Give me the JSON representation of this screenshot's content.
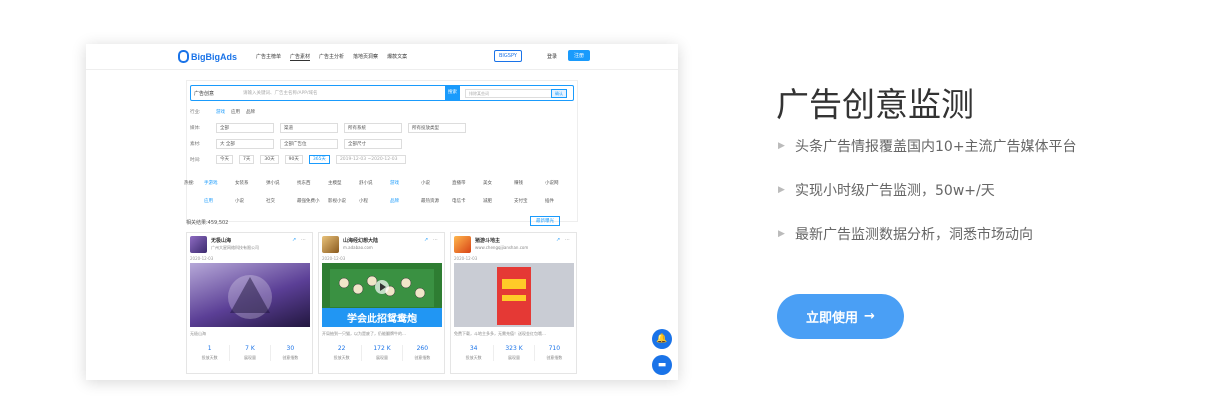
{
  "screenshot": {
    "header": {
      "logo": "BigBigAds",
      "nav": [
        "广告主榜单",
        "广告素材",
        "广告主分析",
        "落地页洞察",
        "爆款文案"
      ],
      "bigspy": "BIGSPY",
      "login": "登录",
      "register": "注册"
    },
    "search": {
      "select": "广告创意",
      "placeholder": "请输入关键词、广告主名称/APP/域名",
      "button": "搜索",
      "exclude_placeholder": "排除某些词",
      "exclude_button": "确认"
    },
    "filters": {
      "industry_label": "行业:",
      "industry": [
        "游戏",
        "应用",
        "品牌"
      ],
      "media_label": "媒体:",
      "media_dd": [
        "全部",
        "渠道",
        "所有系统",
        "所有投放类型"
      ],
      "creative_label": "素材:",
      "creative_dd": [
        "大 全部",
        "全部广告位",
        "全部尺寸"
      ],
      "time_label": "时间:",
      "time_opts": [
        "今天",
        "7天",
        "30天",
        "90天",
        "365天"
      ],
      "date_range": "2019-12-03 ~2020-12-03"
    },
    "hot_label": "热搜:",
    "hot_row1": [
      "手游戏",
      "女装系",
      "弹小说",
      "找东西",
      "主模型",
      "舒小说",
      "游戏",
      "小说",
      "直播带",
      "美女",
      "赚钱",
      "小说网"
    ],
    "hot_row2": [
      "应用",
      "小说",
      "社交",
      "最强免费小",
      "影视小说",
      "小程",
      "品牌",
      "最热资源",
      "电信卡",
      "减肥",
      "支付宝",
      "插件"
    ],
    "result_count": "相关结果:459,502",
    "sort": "最新曝光",
    "cards": [
      {
        "name": "无极山海",
        "company": "广州大星网络科技有限公司",
        "date": "2020-12-03",
        "desc": "无极山海",
        "stats": [
          "1",
          "7 K",
          "30"
        ],
        "stat_labels": [
          "投放天数",
          "展现量",
          "创意指数"
        ],
        "image_text": "",
        "color": "#6b4fa3"
      },
      {
        "name": "山海经幻想大陆",
        "company": "m.adabao.com",
        "date": "2020-12-03",
        "desc": "开局抽到一只猫，以为是废了，仍能翻牌牛的…",
        "stats": [
          "22",
          "172 K",
          "260"
        ],
        "stat_labels": [
          "投放天数",
          "展现量",
          "创意指数"
        ],
        "image_text": "学会此招鸳鸯炮",
        "color": "#2e7d32"
      },
      {
        "name": "猪游斗地主",
        "company": "www.chengqijianshan.com",
        "date": "2020-12-03",
        "desc": "免费下载，斗地主多多，无需充值！送现金红包哦…",
        "stats": [
          "34",
          "323 K",
          "710"
        ],
        "stat_labels": [
          "投放天数",
          "展现量",
          "创意指数"
        ],
        "image_text": "",
        "color": "#c62828"
      }
    ]
  },
  "right": {
    "title": "广告创意监测",
    "features": [
      "头条广告情报覆盖国内10+主流广告媒体平台",
      "实现小时级广告监测，50w+/天",
      "最新广告监测数据分析，洞悉市场动向"
    ],
    "cta": "立即使用",
    "cta_arrow": "→"
  }
}
